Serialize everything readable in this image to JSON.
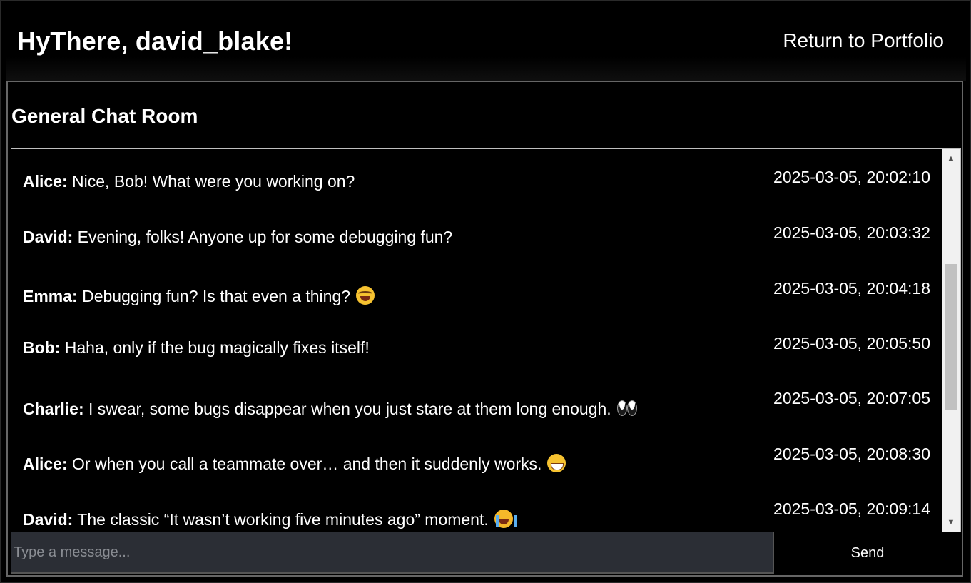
{
  "header": {
    "greeting": "HyThere, david_blake!",
    "portfolio_link": "Return to Portfolio"
  },
  "room": {
    "title": "General Chat Room"
  },
  "messages": [
    {
      "sender": "Alice:",
      "text": " Nice, Bob! What were you working on?",
      "emoji": "",
      "time": "2025-03-05, 20:02:10"
    },
    {
      "sender": "David:",
      "text": " Evening, folks! Anyone up for some debugging fun?",
      "emoji": "",
      "time": "2025-03-05, 20:03:32"
    },
    {
      "sender": "Emma:",
      "text": " Debugging fun? Is that even a thing?",
      "emoji": "face-with-tears-of-joy-icon",
      "time": "2025-03-05, 20:04:18"
    },
    {
      "sender": "Bob:",
      "text": " Haha, only if the bug magically fixes itself!",
      "emoji": "",
      "time": "2025-03-05, 20:05:50"
    },
    {
      "sender": "Charlie:",
      "text": " I swear, some bugs disappear when you just stare at them long enough.",
      "emoji": "eyes-icon",
      "time": "2025-03-05, 20:07:05"
    },
    {
      "sender": "Alice:",
      "text": " Or when you call a teammate over… and then it suddenly works.",
      "emoji": "grinning-sweat-icon",
      "time": "2025-03-05, 20:08:30"
    },
    {
      "sender": "David:",
      "text": " The classic “It wasn’t working five minutes ago” moment.",
      "emoji": "loudly-crying-face-icon",
      "time": "2025-03-05, 20:09:14"
    }
  ],
  "scroll": {
    "position_fraction": 0.28,
    "visible_fraction": 0.42
  },
  "composer": {
    "placeholder": "Type a message...",
    "value": "",
    "send_label": "Send"
  }
}
